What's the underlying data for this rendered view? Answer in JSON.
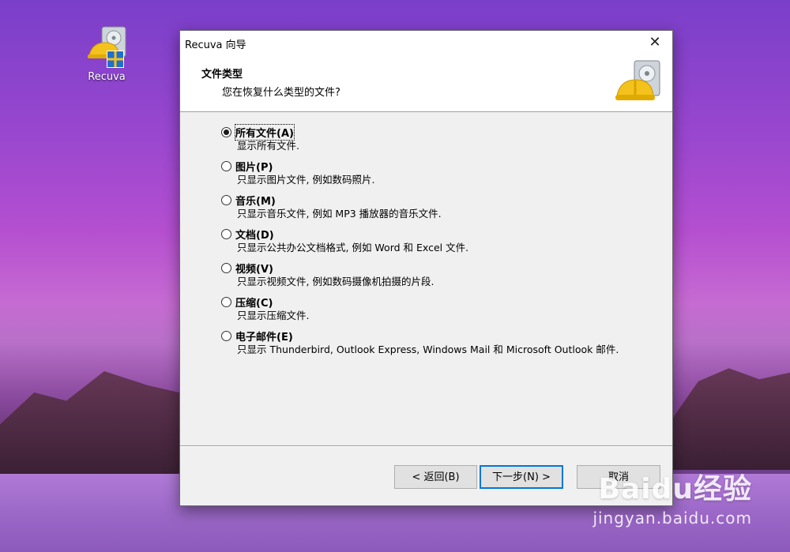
{
  "desktop": {
    "icon_label": "Recuva"
  },
  "dialog": {
    "title": "Recuva 向导",
    "close_glyph": "✕",
    "header_title": "文件类型",
    "header_subtitle": "您在恢复什么类型的文件?",
    "options": [
      {
        "label": "所有文件(A)",
        "desc": "显示所有文件.",
        "checked": true
      },
      {
        "label": "图片(P)",
        "desc": "只显示图片文件, 例如数码照片.",
        "checked": false
      },
      {
        "label": "音乐(M)",
        "desc": "只显示音乐文件, 例如 MP3 播放器的音乐文件.",
        "checked": false
      },
      {
        "label": "文档(D)",
        "desc": "只显示公共办公文档格式, 例如 Word 和 Excel 文件.",
        "checked": false
      },
      {
        "label": "视频(V)",
        "desc": "只显示视频文件, 例如数码摄像机拍摄的片段.",
        "checked": false
      },
      {
        "label": "压缩(C)",
        "desc": "只显示压缩文件.",
        "checked": false
      },
      {
        "label": "电子邮件(E)",
        "desc": "只显示 Thunderbird, Outlook Express, Windows Mail 和 Microsoft Outlook 邮件.",
        "checked": false
      }
    ],
    "buttons": {
      "back": "< 返回(B)",
      "next": "下一步(N) >",
      "cancel": "取消"
    }
  },
  "watermark": {
    "brand": "Baidu经验",
    "url": "jingyan.baidu.com"
  },
  "colors": {
    "accent": "#0078d7",
    "dialog_bg": "#f0f0f0"
  }
}
